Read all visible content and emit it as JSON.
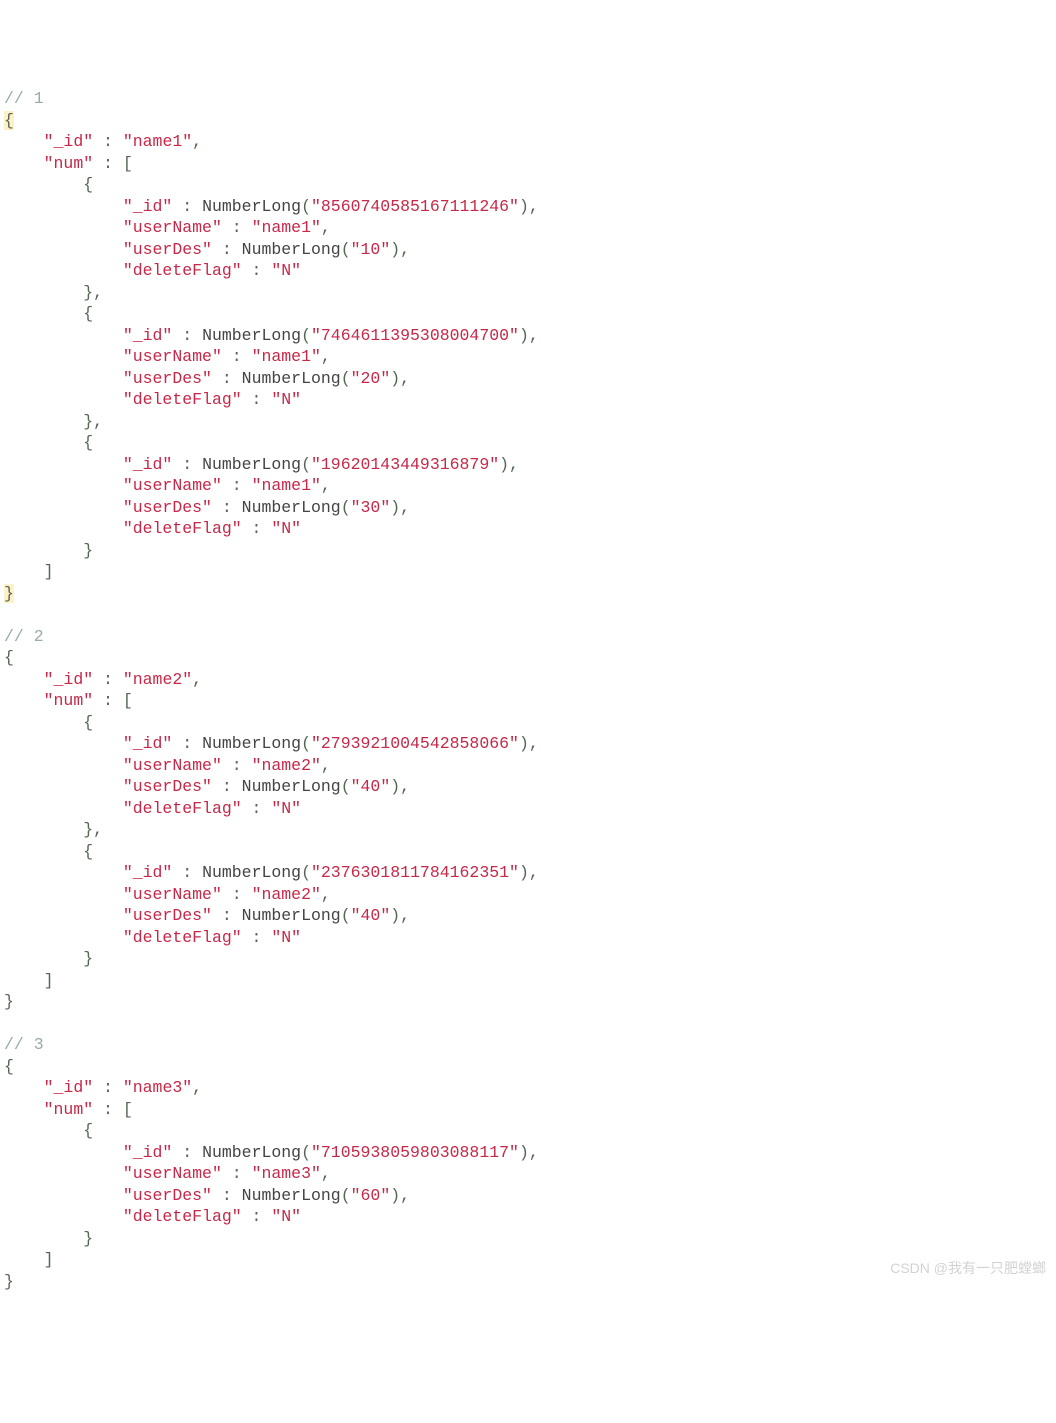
{
  "watermark": "CSDN @我有一只肥螳螂",
  "code_text": {
    "fn_name": "NumberLong",
    "comment_prefix": "// "
  },
  "records": [
    {
      "index": 1,
      "_id": "name1",
      "num": [
        {
          "_id": "8560740585167111246",
          "userName": "name1",
          "userDes": "10",
          "deleteFlag": "N"
        },
        {
          "_id": "7464611395308004700",
          "userName": "name1",
          "userDes": "20",
          "deleteFlag": "N"
        },
        {
          "_id": "19620143449316879",
          "userName": "name1",
          "userDes": "30",
          "deleteFlag": "N"
        }
      ]
    },
    {
      "index": 2,
      "_id": "name2",
      "num": [
        {
          "_id": "2793921004542858066",
          "userName": "name2",
          "userDes": "40",
          "deleteFlag": "N"
        },
        {
          "_id": "2376301811784162351",
          "userName": "name2",
          "userDes": "40",
          "deleteFlag": "N"
        }
      ]
    },
    {
      "index": 3,
      "_id": "name3",
      "num": [
        {
          "_id": "7105938059803088117",
          "userName": "name3",
          "userDes": "60",
          "deleteFlag": "N"
        }
      ]
    }
  ]
}
